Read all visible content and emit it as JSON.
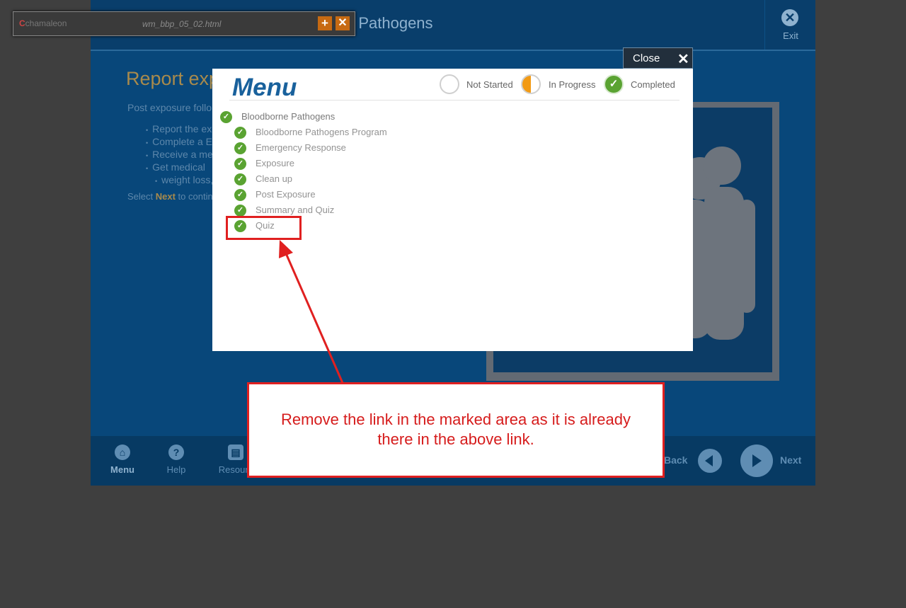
{
  "toolbar": {
    "logo_text": "chamaleon",
    "file_name": "wm_bbp_05_02.html",
    "add_glyph": "+",
    "close_glyph": "✕"
  },
  "course": {
    "title_visible": "e Pathogens",
    "exit_label": "Exit",
    "page_heading": "Report exp",
    "page_intro": "Post exposure follo",
    "bullets": [
      "Report the ex",
      "Complete a E",
      "Receive a me",
      "Get medical",
      "weight loss, c"
    ],
    "select_prefix": "Select ",
    "select_bold": "Next",
    "select_suffix": " to contin"
  },
  "footer": {
    "menu_label": "Menu",
    "help_label": "Help",
    "resources_label": "Resourc",
    "back_label": "Back",
    "next_label": "Next"
  },
  "close_bar": {
    "label": "Close"
  },
  "menu": {
    "title": "Menu",
    "legend": {
      "not_started": "Not Started",
      "in_progress": "In Progress",
      "completed": "Completed"
    },
    "section": {
      "label": "Bloodborne Pathogens",
      "status": "completed"
    },
    "items": [
      {
        "label": "Bloodborne Pathogens Program",
        "status": "completed"
      },
      {
        "label": "Emergency Response",
        "status": "completed"
      },
      {
        "label": "Exposure",
        "status": "completed"
      },
      {
        "label": "Clean up",
        "status": "completed"
      },
      {
        "label": "Post Exposure",
        "status": "completed"
      },
      {
        "label": "Summary and Quiz",
        "status": "completed"
      },
      {
        "label": "Quiz",
        "status": "completed"
      }
    ]
  },
  "annotation": {
    "callout_text": "Remove the link in the marked area as it is already there in the above link.",
    "color": "#e02020"
  },
  "colors": {
    "course_bg": "#08477a",
    "menu_title": "#19619c",
    "completed_green": "#5aa332",
    "accent_orange": "#c76a12"
  }
}
